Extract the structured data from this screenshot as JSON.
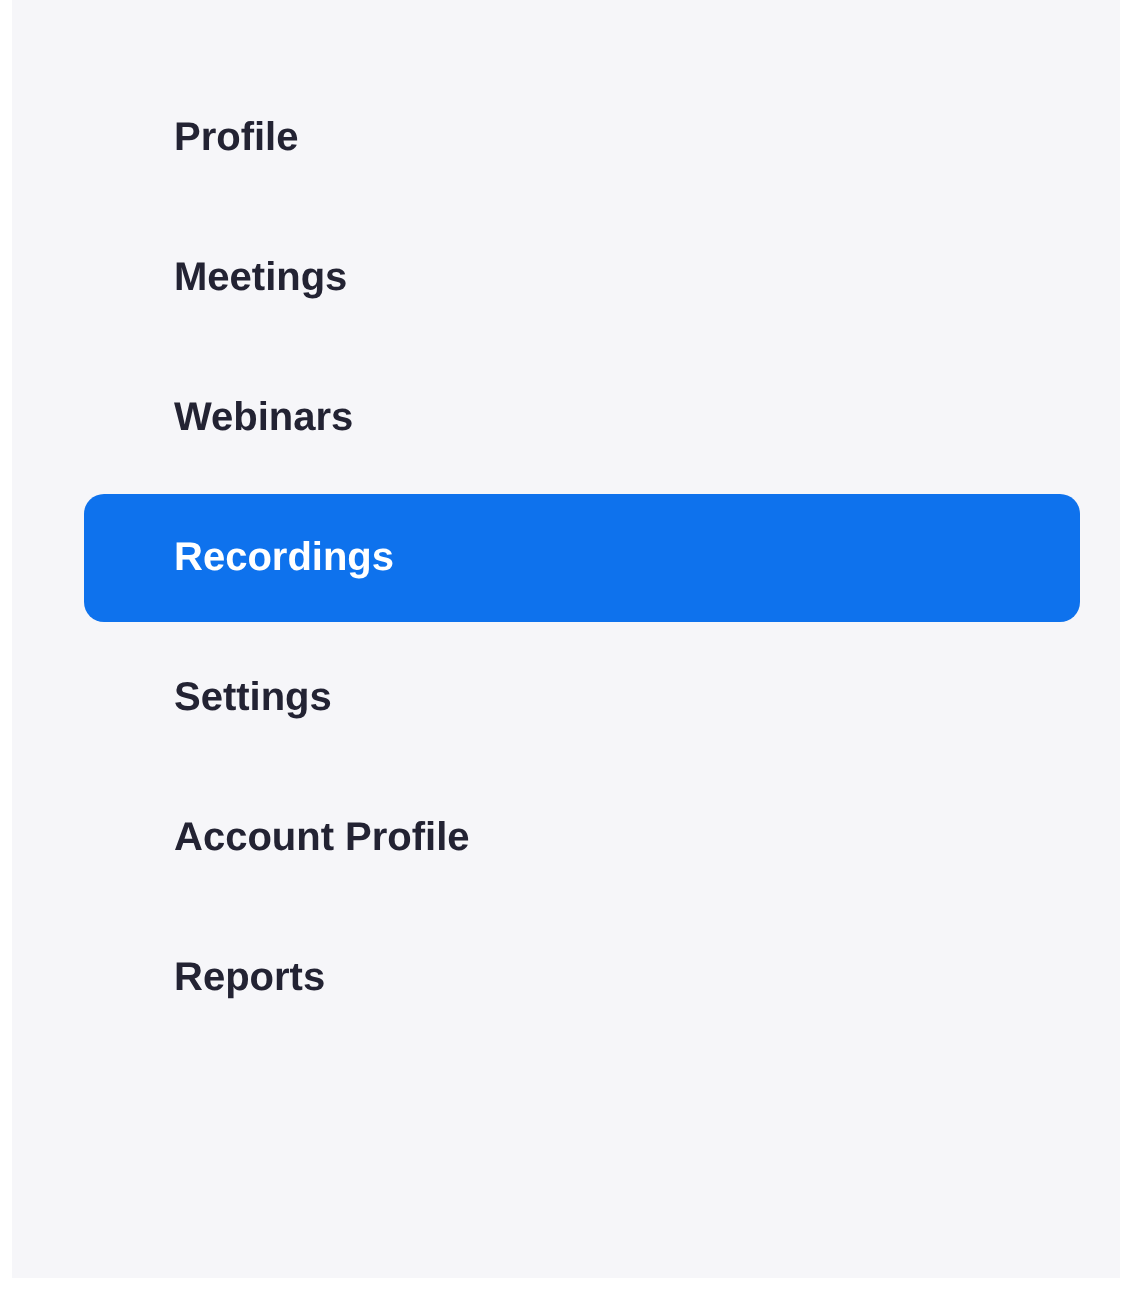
{
  "sidebar": {
    "items": [
      {
        "label": "Profile",
        "selected": false
      },
      {
        "label": "Meetings",
        "selected": false
      },
      {
        "label": "Webinars",
        "selected": false
      },
      {
        "label": "Recordings",
        "selected": true
      },
      {
        "label": "Settings",
        "selected": false
      },
      {
        "label": "Account Profile",
        "selected": false
      },
      {
        "label": "Reports",
        "selected": false
      }
    ]
  }
}
